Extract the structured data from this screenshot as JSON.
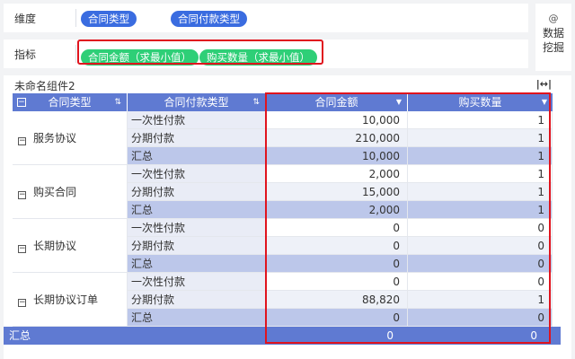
{
  "dimensions": {
    "label": "维度",
    "fields": [
      "合同类型",
      "合同付款类型"
    ]
  },
  "indicators": {
    "label": "指标",
    "fields": [
      "合同金额（求最小值）",
      "购买数量（求最小值）"
    ]
  },
  "side_button": {
    "icon": "@",
    "label_line1": "数据",
    "label_line2": "挖掘"
  },
  "widget": {
    "title": "未命名组件2",
    "expand_icon": "|↔|"
  },
  "table": {
    "headers": [
      "合同类型",
      "合同付款类型",
      "合同金额",
      "购买数量"
    ],
    "groups": [
      {
        "name": "服务协议",
        "rows": [
          {
            "pay": "一次性付款",
            "amount": "10,000",
            "qty": "1"
          },
          {
            "pay": "分期付款",
            "amount": "210,000",
            "qty": "1"
          },
          {
            "pay": "汇总",
            "amount": "10,000",
            "qty": "1"
          }
        ]
      },
      {
        "name": "购买合同",
        "rows": [
          {
            "pay": "一次性付款",
            "amount": "2,000",
            "qty": "1"
          },
          {
            "pay": "分期付款",
            "amount": "15,000",
            "qty": "1"
          },
          {
            "pay": "汇总",
            "amount": "2,000",
            "qty": "1"
          }
        ]
      },
      {
        "name": "长期协议",
        "rows": [
          {
            "pay": "一次性付款",
            "amount": "0",
            "qty": "0"
          },
          {
            "pay": "分期付款",
            "amount": "0",
            "qty": "0"
          },
          {
            "pay": "汇总",
            "amount": "0",
            "qty": "0"
          }
        ]
      },
      {
        "name": "长期协议订单",
        "rows": [
          {
            "pay": "一次性付款",
            "amount": "0",
            "qty": "0"
          },
          {
            "pay": "分期付款",
            "amount": "88,820",
            "qty": "1"
          },
          {
            "pay": "汇总",
            "amount": "0",
            "qty": "0"
          }
        ]
      }
    ],
    "total": {
      "label": "汇总",
      "amount": "0",
      "qty": "0"
    }
  }
}
